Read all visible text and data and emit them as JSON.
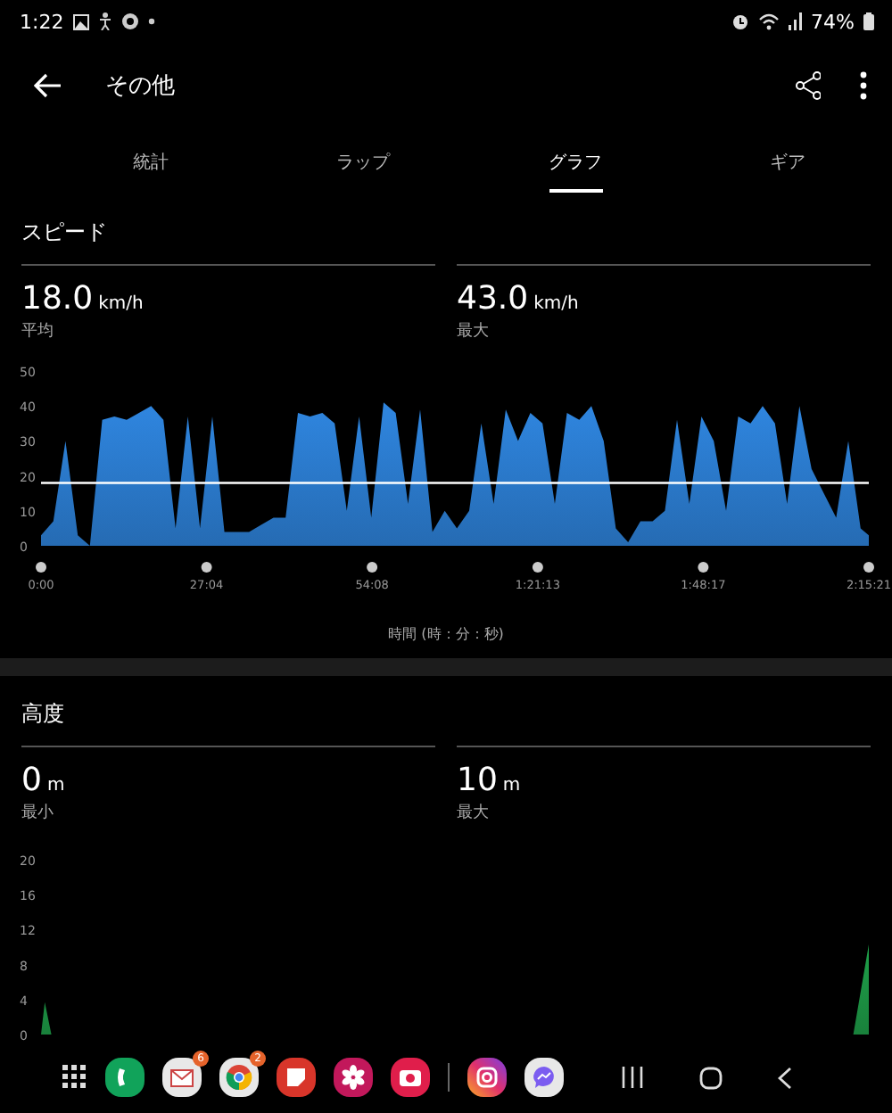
{
  "status_bar": {
    "time": "1:22",
    "battery": "74%"
  },
  "app_bar": {
    "title": "その他"
  },
  "tabs": [
    {
      "label": "統計",
      "selected": false
    },
    {
      "label": "ラップ",
      "selected": false
    },
    {
      "label": "グラフ",
      "selected": true
    },
    {
      "label": "ギア",
      "selected": false
    }
  ],
  "sections": [
    {
      "title": "スピード",
      "stats": [
        {
          "value": "18.0",
          "unit": "km/h",
          "label": "平均"
        },
        {
          "value": "43.0",
          "unit": "km/h",
          "label": "最大"
        }
      ],
      "chart_data": {
        "type": "area",
        "xlabel": "時間 (時：分：秒)",
        "x": [
          0,
          2,
          4,
          6,
          8,
          10,
          12,
          14,
          16,
          18,
          20,
          22,
          24,
          26,
          28,
          30,
          32,
          34,
          36,
          38,
          40,
          42,
          44,
          46,
          48,
          50,
          52,
          54,
          56,
          58,
          60,
          62,
          64,
          66,
          68,
          70,
          72,
          74,
          76,
          78,
          80,
          82,
          84,
          86,
          88,
          90,
          92,
          94,
          96,
          98,
          100,
          102,
          104,
          106,
          108,
          110,
          112,
          114,
          116,
          118,
          120,
          122,
          124,
          126,
          128,
          130,
          132,
          134,
          135.35
        ],
        "series": [
          {
            "color": "#2f86e0",
            "values": [
              3,
              7,
              30,
              3,
              0,
              36,
              37,
              36,
              38,
              40,
              36,
              5,
              37,
              5,
              37,
              4,
              4,
              4,
              6,
              8,
              8,
              38,
              37,
              38,
              35,
              10,
              37,
              8,
              41,
              38,
              12,
              39,
              4,
              10,
              5,
              10,
              35,
              12,
              39,
              30,
              38,
              35,
              12,
              38,
              36,
              40,
              30,
              5,
              1,
              7,
              7,
              10,
              36,
              12,
              37,
              30,
              10,
              37,
              35,
              40,
              35,
              12,
              40,
              22,
              15,
              8,
              30,
              5,
              3
            ]
          }
        ],
        "xlim": [
          0,
          135.35
        ],
        "ylim": [
          0,
          50
        ],
        "xticks": [
          {
            "value": 0,
            "label": "0:00"
          },
          {
            "value": 27.07,
            "label": "27:04"
          },
          {
            "value": 54.13,
            "label": "54:08"
          },
          {
            "value": 81.22,
            "label": "1:21:13"
          },
          {
            "value": 108.28,
            "label": "1:48:17"
          },
          {
            "value": 135.35,
            "label": "2:15:21"
          }
        ],
        "yticks": [
          0,
          10,
          20,
          30,
          40,
          50
        ],
        "ref_lines": [
          {
            "axis": "y",
            "value": 18
          }
        ]
      }
    },
    {
      "title": "高度",
      "stats": [
        {
          "value": "0",
          "unit": "m",
          "label": "最小"
        },
        {
          "value": "10",
          "unit": "m",
          "label": "最大"
        }
      ],
      "chart_data": {
        "type": "area",
        "x": [
          0,
          0.6,
          1.7,
          132.8,
          135.35
        ],
        "series": [
          {
            "color": "#1fa14a",
            "values": [
              0,
              3.7,
              0,
              0,
              10.3
            ]
          }
        ],
        "xlim": [
          0,
          135.35
        ],
        "ylim": [
          0,
          20
        ],
        "yticks": [
          0,
          4,
          8,
          12,
          16,
          20
        ]
      }
    }
  ],
  "dock": {
    "apps": [
      {
        "kind": "grid"
      },
      {
        "kind": "phone"
      },
      {
        "kind": "mail",
        "badge": "6"
      },
      {
        "kind": "browser",
        "badge": "2"
      },
      {
        "kind": "notes"
      },
      {
        "kind": "flower"
      },
      {
        "kind": "camera"
      },
      {
        "kind": "divider"
      },
      {
        "kind": "photo"
      },
      {
        "kind": "chat"
      }
    ]
  }
}
